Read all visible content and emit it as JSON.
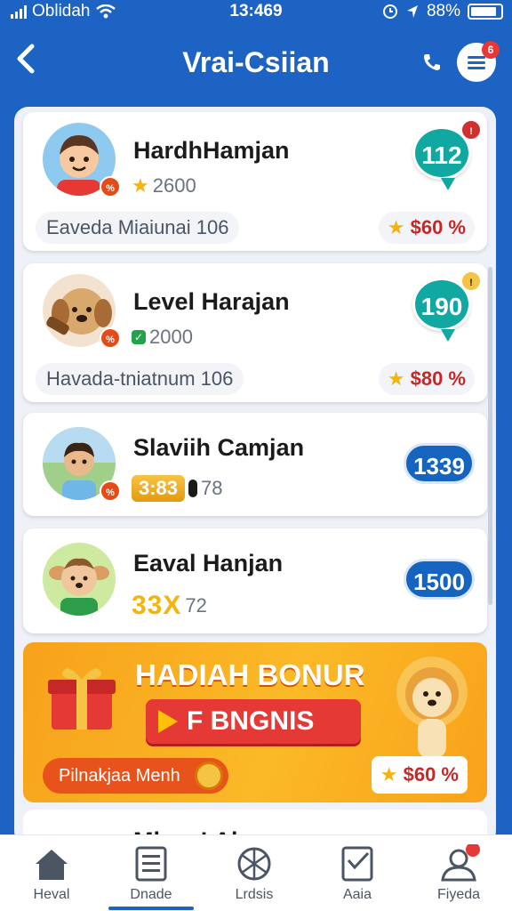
{
  "status_bar": {
    "carrier": "Oblidah",
    "time": "13:469",
    "battery": "88%"
  },
  "header": {
    "title": "Vrai-Csiian",
    "notification_count": "6"
  },
  "players": [
    {
      "name": "HardhHamjan",
      "stat": "2600",
      "stat_icon": "star-icon",
      "info": "Eaveda Miaiunai 106",
      "reward": "$60 %",
      "score": "112",
      "score_style": "bubble",
      "score_badge": "!"
    },
    {
      "name": "Level Harajan",
      "stat": "2000",
      "stat_icon": "check-icon",
      "info": "Havada-tniatnum 106",
      "reward": "$80 %",
      "score": "190",
      "score_style": "bubble",
      "score_badge": "!"
    },
    {
      "name": "Slaviih Camjan",
      "badge": "3:83",
      "stat": "78",
      "score": "1339",
      "score_style": "pill"
    },
    {
      "name": "Eaval Hanjan",
      "badge": "33X",
      "stat": "72",
      "score": "1500",
      "score_style": "pill"
    }
  ],
  "banner": {
    "title": "HADIAH BONUR",
    "cta_label": "F BNGNIS",
    "pill_label": "Pilnakjaa Menh",
    "reward": "$60 %"
  },
  "partial_card": {
    "name": "Mlasa! Alaana"
  },
  "nav": {
    "items": [
      "Heval",
      "Dnade",
      "Lrdsis",
      "Aaia",
      "Fiyeda"
    ],
    "active_index": 1
  },
  "colors": {
    "primary": "#1c63c4",
    "accent_red": "#e53935",
    "gold": "#f3b412",
    "teal": "#10a8a0"
  }
}
